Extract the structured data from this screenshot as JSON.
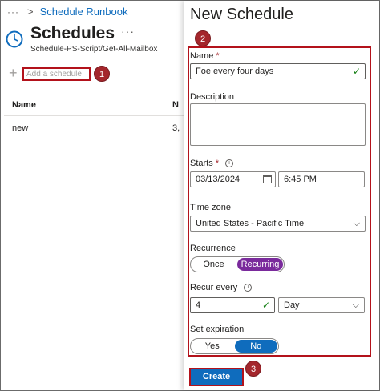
{
  "breadcrumb": {
    "more": "···",
    "sep": ">",
    "item": "Schedule Runbook"
  },
  "header": {
    "title": "Schedules",
    "more": "···",
    "subtitle": "Schedule-PS-Script/Get-All-Mailbox"
  },
  "toolbar": {
    "add_plus": "+",
    "add_schedule_label": "Add a schedule"
  },
  "annotations": {
    "one": "1",
    "two": "2",
    "three": "3"
  },
  "table": {
    "columns": [
      "Name",
      "N"
    ],
    "rows": [
      {
        "name": "new",
        "next": "3,"
      }
    ]
  },
  "panel": {
    "title": "New Schedule",
    "name": {
      "label": "Name",
      "required": "*",
      "value": "Foe every four days"
    },
    "description": {
      "label": "Description",
      "value": ""
    },
    "starts": {
      "label": "Starts",
      "required": "*",
      "date": "03/13/2024",
      "time": "6:45 PM"
    },
    "timezone": {
      "label": "Time zone",
      "value": "United States - Pacific Time"
    },
    "recurrence": {
      "label": "Recurrence",
      "options": [
        "Once",
        "Recurring"
      ],
      "selected": "Recurring"
    },
    "recur_every": {
      "label": "Recur every",
      "value": "4",
      "unit": "Day"
    },
    "set_expiration": {
      "label": "Set expiration",
      "options": [
        "Yes",
        "No"
      ],
      "selected": "No"
    },
    "create_label": "Create"
  },
  "colors": {
    "accent": "#0f6cbd",
    "highlight": "#b3121b",
    "recurring": "#7a2a9c",
    "badge": "#a4262c"
  },
  "icons": {
    "clock": "clock-icon",
    "info": "info-icon",
    "calendar": "calendar-icon",
    "check": "checkmark-icon",
    "chevron": "chevron-down-icon"
  }
}
